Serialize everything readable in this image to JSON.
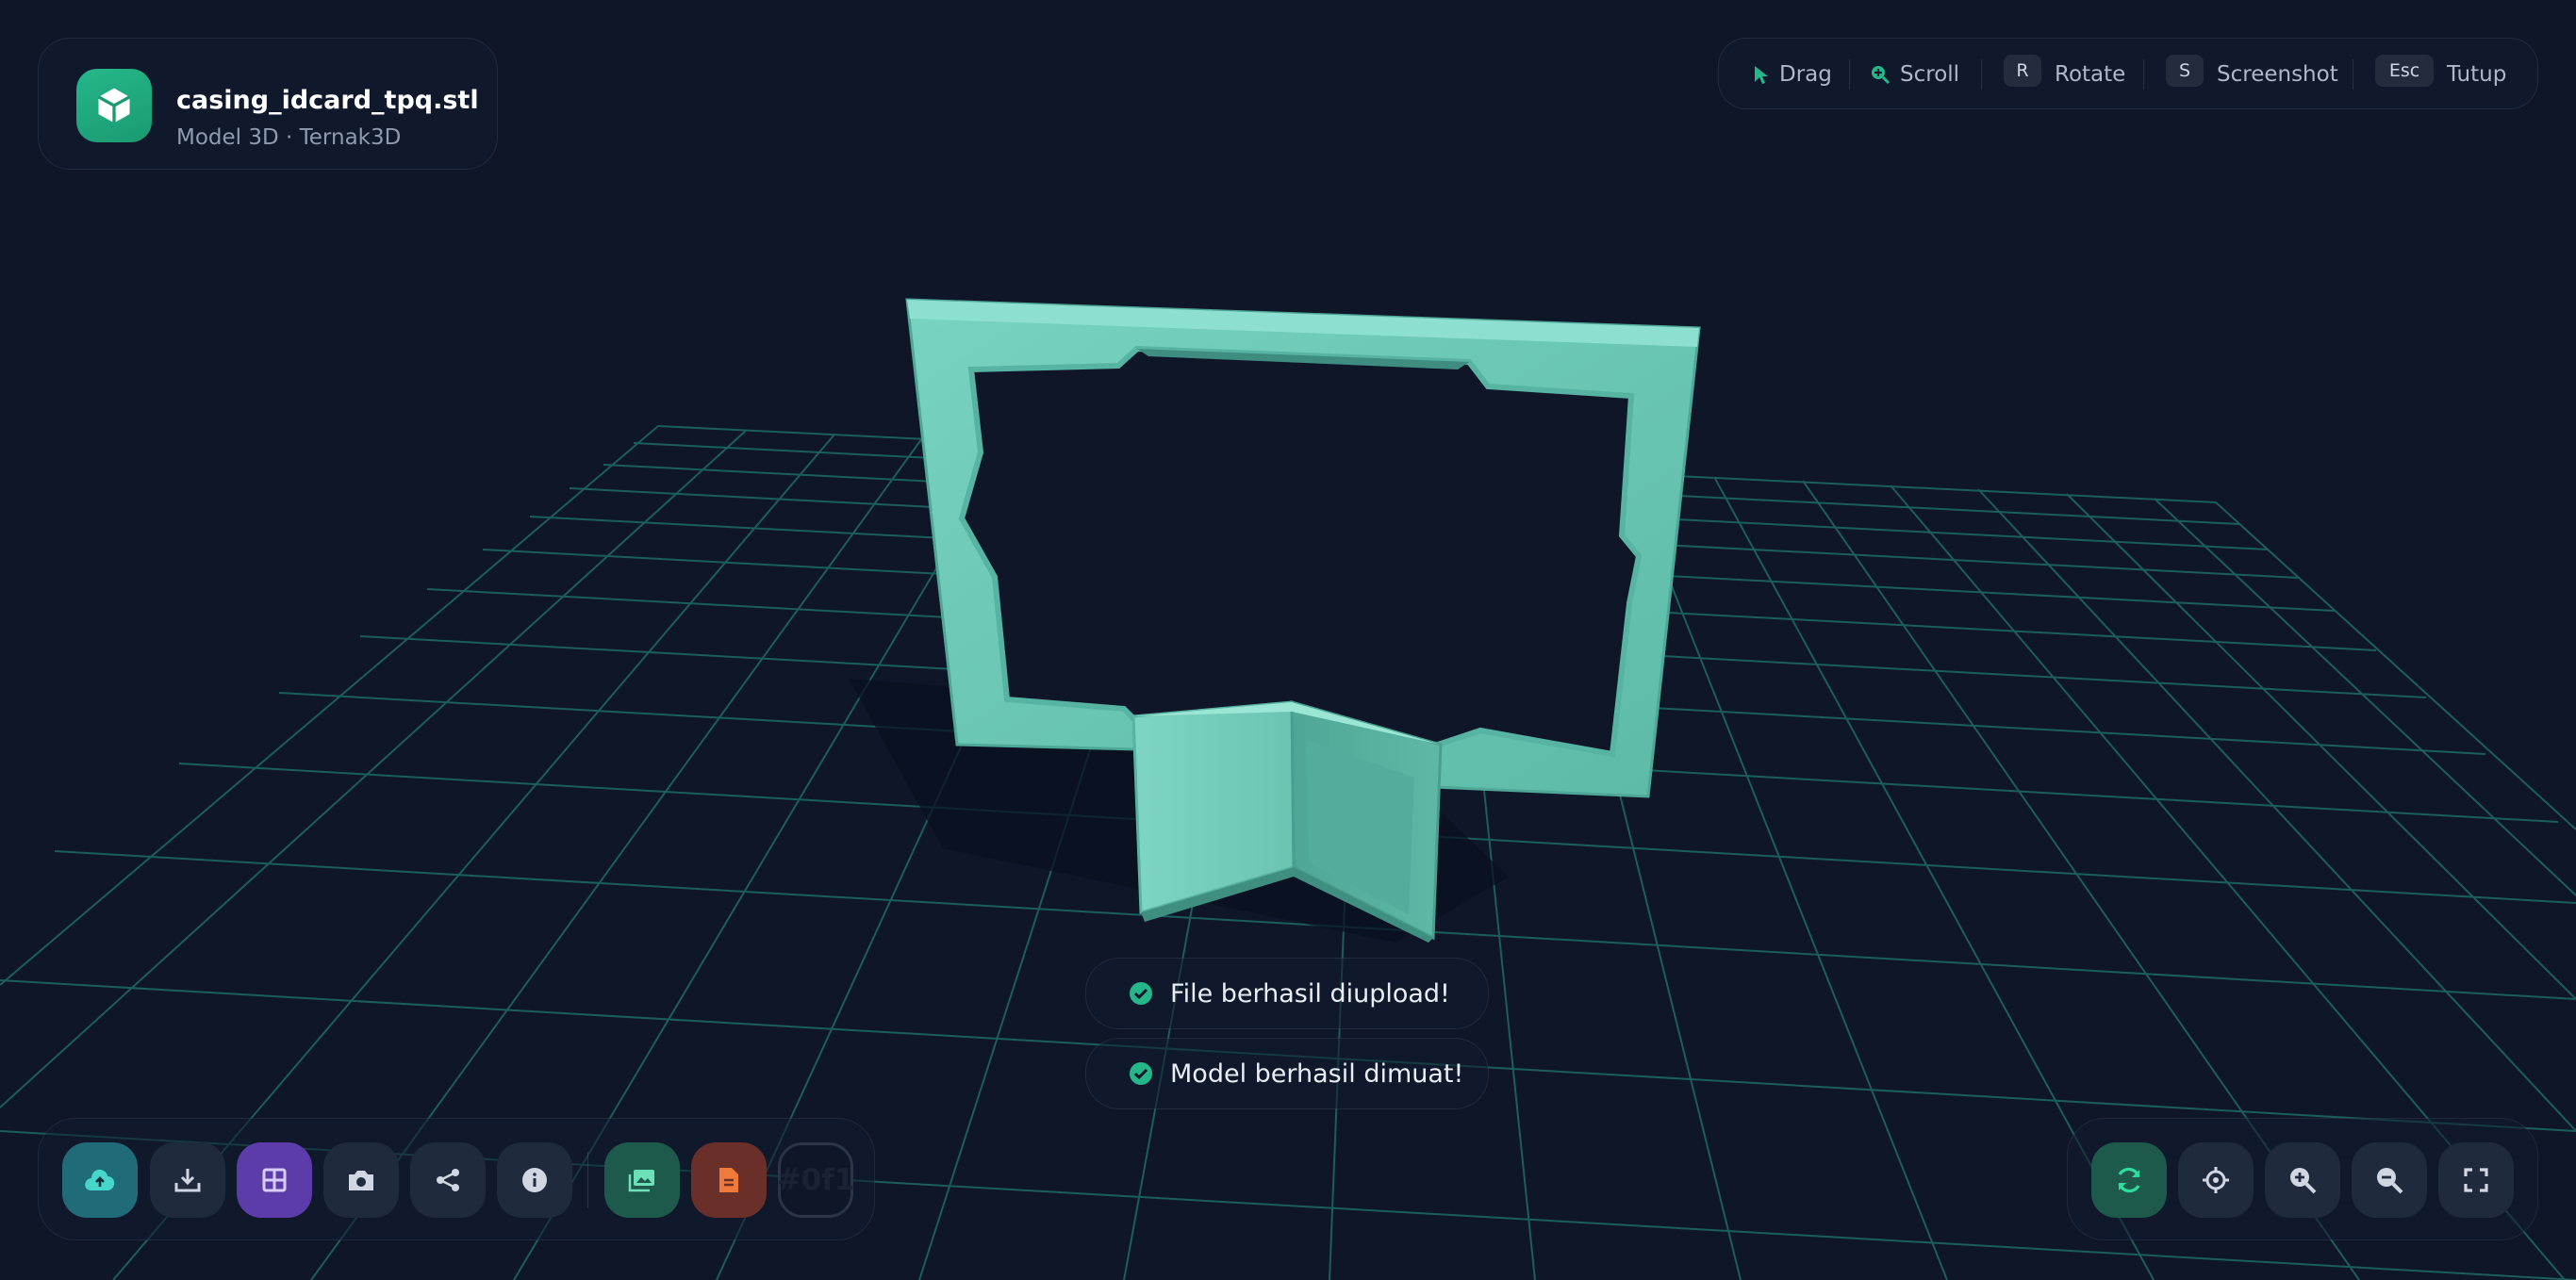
{
  "header": {
    "filename": "casing_idcard_tpq.stl",
    "subtitle": "Model 3D · Ternak3D"
  },
  "hints": [
    {
      "key": "",
      "icon": "cursor-icon",
      "label": "Drag"
    },
    {
      "key": "",
      "icon": "zoom-in-icon",
      "label": "Scroll"
    },
    {
      "key": "R",
      "icon": "",
      "label": "Rotate"
    },
    {
      "key": "S",
      "icon": "",
      "label": "Screenshot"
    },
    {
      "key": "Esc",
      "icon": "",
      "label": "Tutup"
    }
  ],
  "toasts": [
    {
      "icon": "check-circle-icon",
      "text": "File berhasil diupload!"
    },
    {
      "icon": "check-circle-icon",
      "text": "Model berhasil dimuat!"
    }
  ],
  "left_toolbar": [
    {
      "icon": "cloud-upload-icon",
      "color": "#1f6b78"
    },
    {
      "icon": "download-icon",
      "color": "#1f2a3c"
    },
    {
      "icon": "grid-icon",
      "color": "#5b3ca8"
    },
    {
      "icon": "camera-icon",
      "color": "#1f2a3c"
    },
    {
      "icon": "share-icon",
      "color": "#1f2a3c"
    },
    {
      "icon": "info-icon",
      "color": "#1f2a3c"
    },
    {
      "icon": "image-icon",
      "color": "#1e5a4c"
    },
    {
      "icon": "document-icon",
      "color": "#6b2f2a"
    }
  ],
  "color_picker": {
    "value": "#0f1"
  },
  "right_toolbar": [
    {
      "icon": "refresh-icon",
      "color": "#1e5a4c"
    },
    {
      "icon": "crosshair-icon",
      "color": "#1f2a3c"
    },
    {
      "icon": "zoom-in-icon",
      "color": "#1f2a3c"
    },
    {
      "icon": "zoom-out-icon",
      "color": "#1f2a3c"
    },
    {
      "icon": "fullscreen-icon",
      "color": "#1f2a3c"
    }
  ],
  "colors": {
    "background": "#0e1628",
    "grid": "#1f6b66",
    "model": "#6cc9b7",
    "accent": "#25b789"
  }
}
